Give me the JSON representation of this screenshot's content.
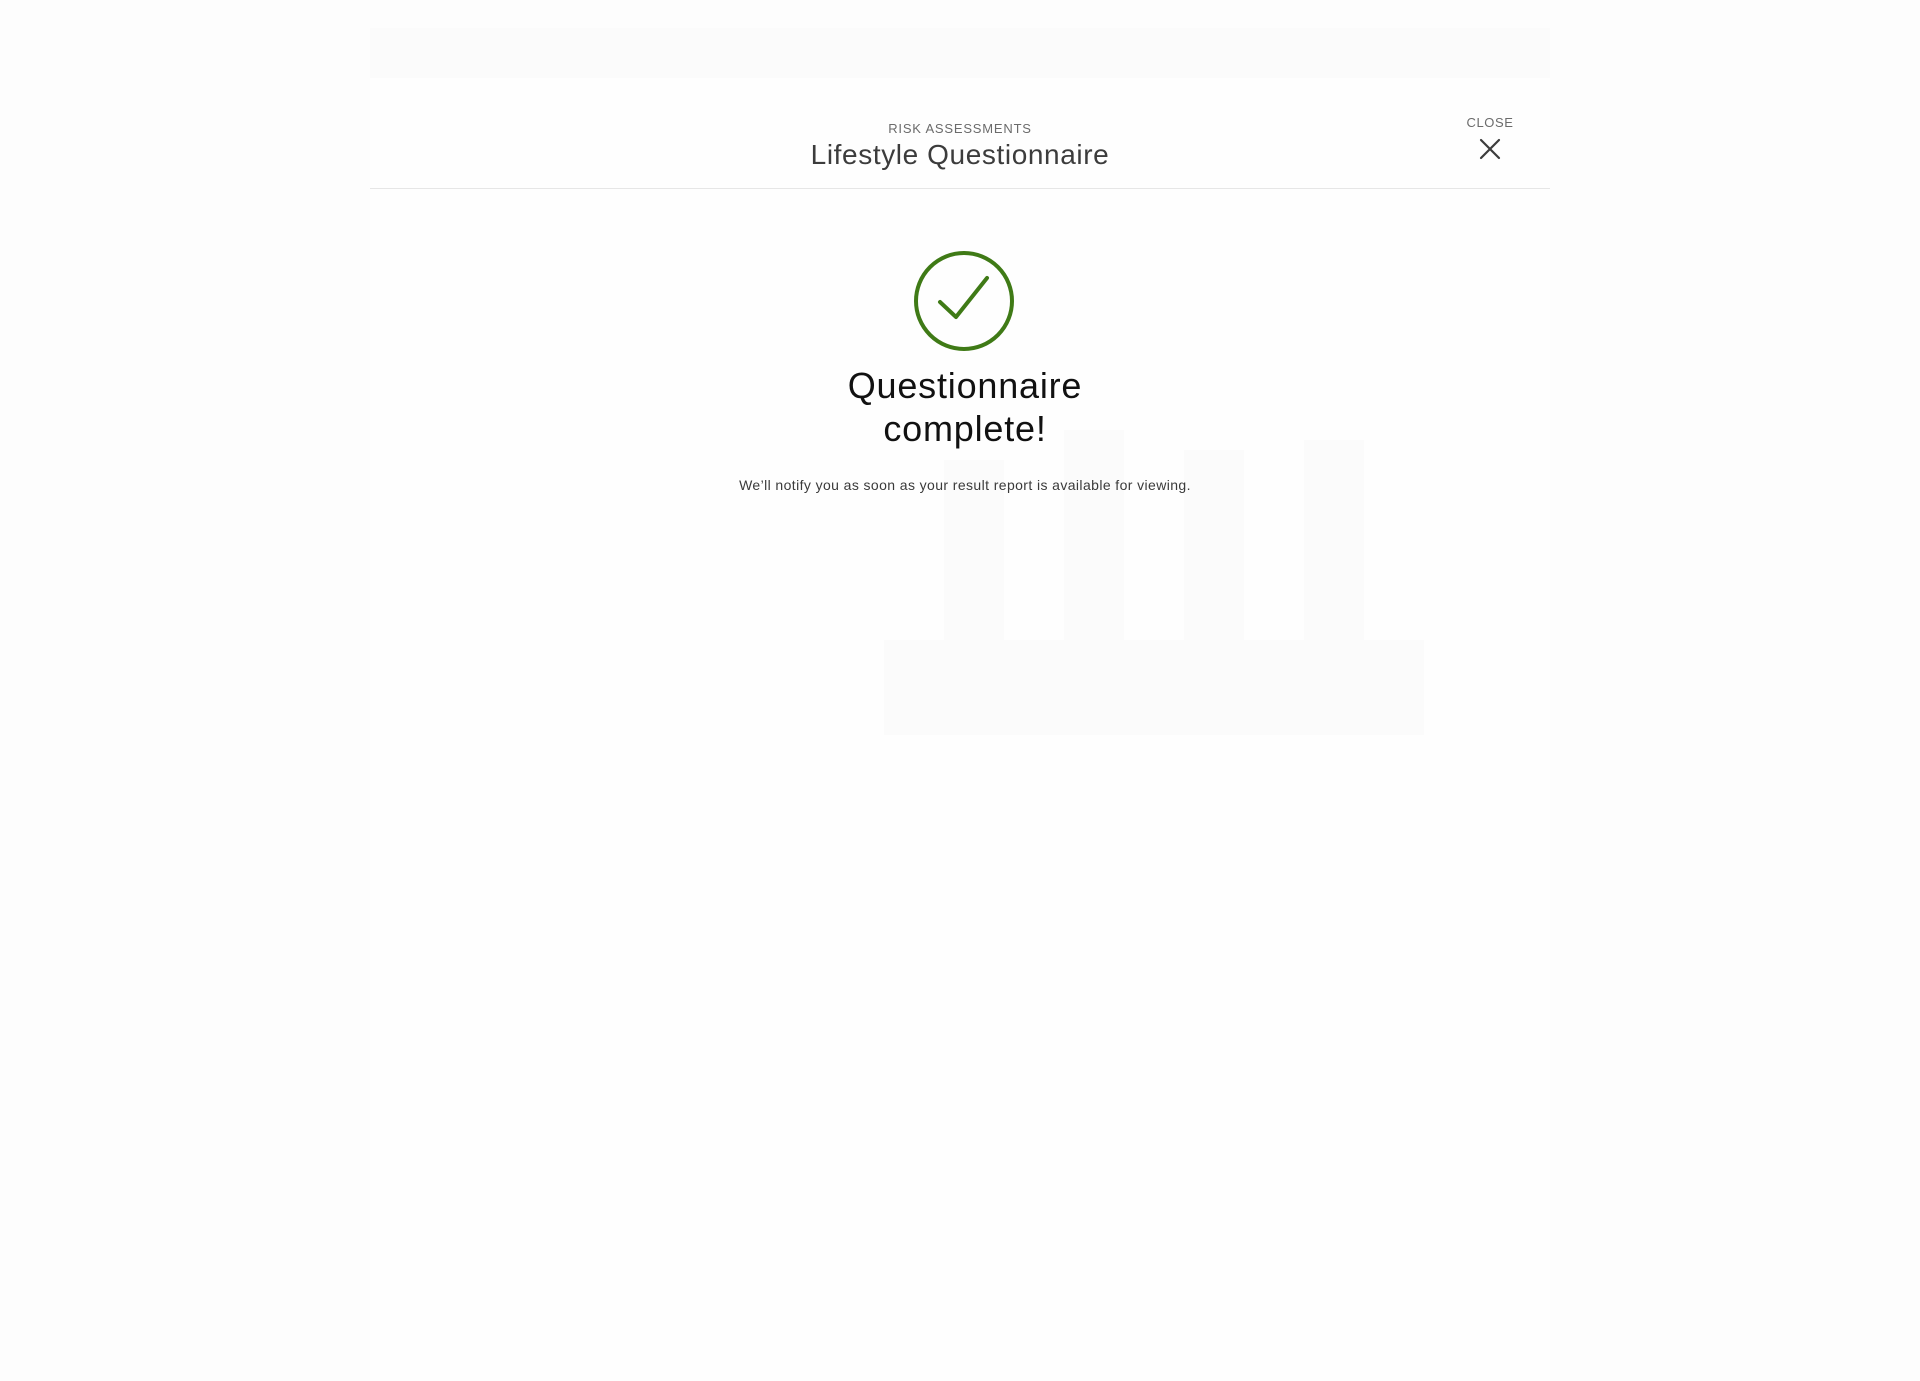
{
  "header": {
    "breadcrumb": "RISK ASSESSMENTS",
    "title": "Lifestyle Questionnaire",
    "close_label": "CLOSE"
  },
  "status": {
    "headline_line1": "Questionnaire",
    "headline_line2": "complete!",
    "message": "We’ll notify you as soon as your result report is available for viewing."
  },
  "icons": {
    "success": "check-circle-icon",
    "close": "close-icon"
  },
  "colors": {
    "success": "#3f7a16",
    "text_primary": "#111111",
    "text_secondary": "#6b6b6b"
  }
}
